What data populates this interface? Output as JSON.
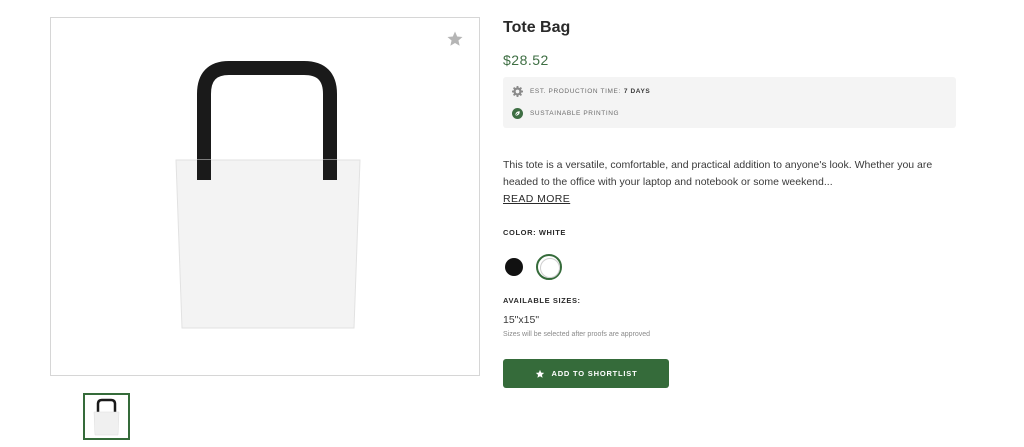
{
  "product": {
    "title": "Tote Bag",
    "price": "$28.52",
    "info": {
      "production_label": "EST. PRODUCTION TIME:",
      "production_value": "7 DAYS",
      "sustainable_label": "SUSTAINABLE PRINTING"
    },
    "description": "This tote is a versatile, comfortable, and practical addition to anyone's look. Whether you are headed to the office with your laptop and notebook or some weekend...",
    "read_more": "READ MORE",
    "color_label": "COLOR: WHITE",
    "colors": [
      {
        "name": "black",
        "hex": "#111111",
        "selected": false
      },
      {
        "name": "white",
        "hex": "#ffffff",
        "selected": true
      }
    ],
    "sizes_label": "AVAILABLE SIZES:",
    "size_value": "15\"x15\"",
    "size_note": "Sizes will be selected after proofs are approved",
    "shortlist_button": "ADD TO SHORTLIST"
  },
  "icons": {
    "favorite": "star-icon",
    "production": "gear-icon",
    "sustainable": "leaf-icon",
    "shortlist": "star-icon"
  },
  "theme": {
    "accent": "#356b3a",
    "price_color": "#3e6e43",
    "info_bg": "#f4f4f4"
  }
}
